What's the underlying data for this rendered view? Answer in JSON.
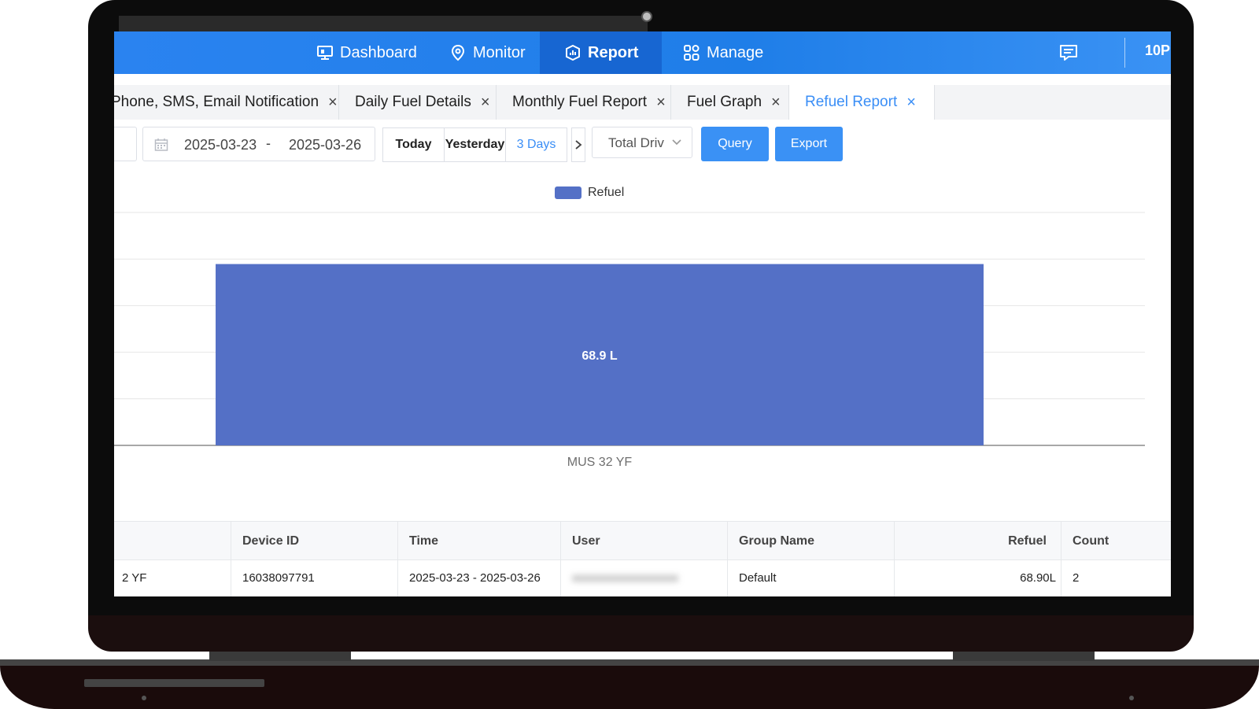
{
  "nav": {
    "items": [
      {
        "label": "Dashboard",
        "icon": "monitor-icon"
      },
      {
        "label": "Monitor",
        "icon": "location-pin-icon"
      },
      {
        "label": "Report",
        "icon": "report-chart-icon"
      },
      {
        "label": "Manage",
        "icon": "grid-icon"
      }
    ],
    "active": "Report",
    "user_id": "10P"
  },
  "tabs": [
    {
      "label": "Phone, SMS, Email Notification"
    },
    {
      "label": "Daily Fuel Details"
    },
    {
      "label": "Monthly Fuel Report"
    },
    {
      "label": "Fuel Graph"
    },
    {
      "label": "Refuel Report",
      "active": true
    }
  ],
  "filters": {
    "start_date": "2025-03-23",
    "date_separator": "-",
    "end_date": "2025-03-26",
    "quick_ranges": [
      "Today",
      "Yesterday",
      "3 Days"
    ],
    "active_range": "3 Days",
    "select_value": "Total Driv",
    "query_label": "Query",
    "export_label": "Export"
  },
  "chart_data": {
    "type": "bar",
    "categories": [
      "MUS 32 YF"
    ],
    "series": [
      {
        "name": "Refuel",
        "values": [
          68.9
        ]
      }
    ],
    "data_labels": [
      "68.9 L"
    ],
    "legend_position": "top-center",
    "grid": true,
    "colors": {
      "bar": "#5470c6"
    }
  },
  "table": {
    "headers": [
      "Device ID",
      "Time",
      "User",
      "Group Name",
      "Refuel",
      "Count"
    ],
    "rows": [
      {
        "name_partial": "2 YF",
        "device_id": "16038097791",
        "time": "2025-03-23 - 2025-03-26",
        "user": "xxxxxxxxxxxxxxxxxx",
        "group": "Default",
        "refuel": "68.90L",
        "count": "2"
      }
    ]
  },
  "colors": {
    "nav_blue": "#2a83f0",
    "accent": "#3a8ef6",
    "bar": "#5470c6"
  }
}
